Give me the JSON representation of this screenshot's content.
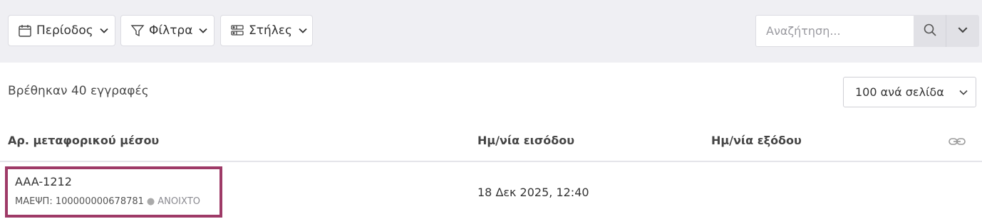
{
  "toolbar": {
    "period_label": "Περίοδος",
    "filters_label": "Φίλτρα",
    "columns_label": "Στήλες",
    "search_placeholder": "Αναζήτηση..."
  },
  "results": {
    "count_text": "Βρέθηκαν 40 εγγραφές",
    "per_page": "100 ανά σελίδα"
  },
  "table": {
    "columns": [
      "Αρ. μεταφορικού μέσου",
      "Ημ/νία εισόδου",
      "Ημ/νία εξόδου"
    ],
    "rows": [
      {
        "vehicle_no": "AAA-1212",
        "maepsp": "ΜΑΕΨΠ: 100000000678781",
        "status": "ΑΝΟΙΧΤΟ",
        "entry_date": "18 Δεκ 2025, 12:40",
        "exit_date": ""
      }
    ]
  },
  "colors": {
    "highlight": "#9e3a67",
    "toolbar_bg": "#efeff3"
  },
  "icons": [
    "calendar-icon",
    "filter-icon",
    "columns-icon",
    "chevron-down-icon",
    "search-icon",
    "link-icon"
  ]
}
